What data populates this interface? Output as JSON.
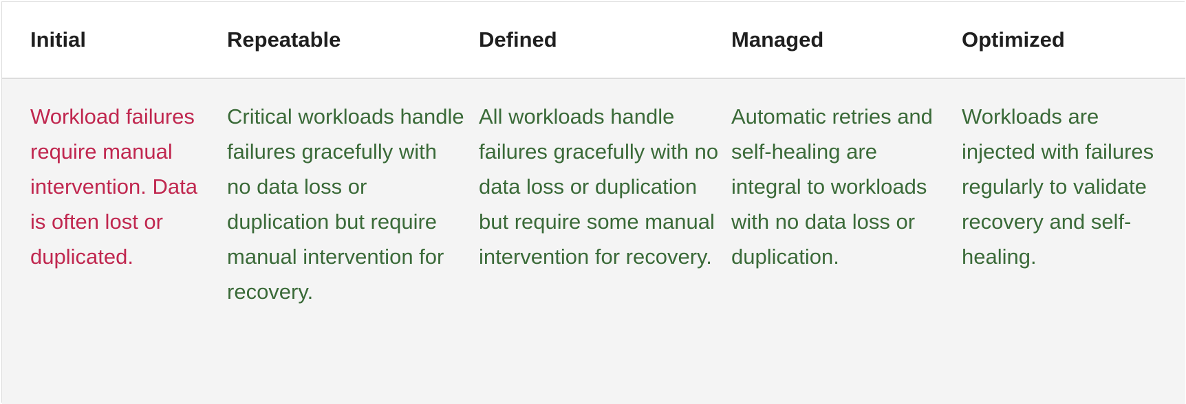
{
  "table": {
    "headers": [
      "Initial",
      "Repeatable",
      "Defined",
      "Managed",
      "Optimized"
    ],
    "cells": [
      "Workload failures require manual intervention. Data is often lost or duplicated.",
      "Critical workloads handle failures gracefully with no data loss or duplication but require manual intervention for recovery.",
      "All workloads handle failures gracefully with no data loss or duplication but require some manual intervention for recovery.",
      "Automatic retries and self-healing are integral to workloads with no data loss or duplication.",
      "Workloads are injected with failures regularly to validate recovery and self-healing."
    ]
  },
  "colors": {
    "initial_text": "#c0274f",
    "level_text": "#3a6a38",
    "header_text": "#1f1f1f",
    "body_background": "#f4f4f4"
  }
}
